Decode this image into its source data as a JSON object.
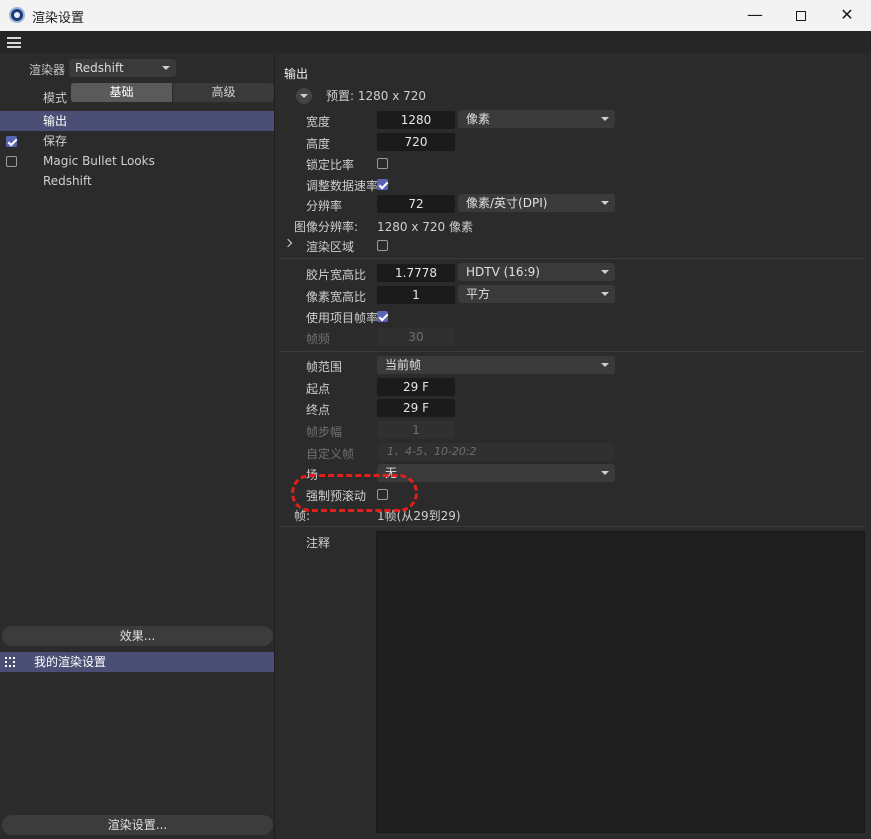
{
  "window": {
    "title": "渲染设置",
    "min_glyph": "—",
    "close_glyph": "✕"
  },
  "left": {
    "renderer_label": "渲染器",
    "renderer_value": "Redshift",
    "mode_label": "模式",
    "mode_basic": "基础",
    "mode_advanced": "高级",
    "items": [
      {
        "label": "输出",
        "checkbox": null,
        "selected": true
      },
      {
        "label": "保存",
        "checkbox": true,
        "selected": false
      },
      {
        "label": "Magic Bullet Looks",
        "checkbox": false,
        "selected": false
      },
      {
        "label": "Redshift",
        "checkbox": null,
        "selected": false
      }
    ],
    "effects_button": "效果...",
    "preset_item": "我的渲染设置",
    "render_settings_button": "渲染设置..."
  },
  "output": {
    "title": "输出",
    "preset": "预置: 1280 x 720",
    "width_label": "宽度",
    "width_value": "1280",
    "width_unit": "像素",
    "height_label": "高度",
    "height_value": "720",
    "lock_ratio_label": "锁定比率",
    "adjust_rate_label": "调整数据速率",
    "resolution_label": "分辨率",
    "resolution_value": "72",
    "resolution_unit": "像素/英寸(DPI)",
    "image_res_label": "图像分辨率:",
    "image_res_value": "1280 x 720 像素",
    "render_region_label": "渲染区域",
    "film_aspect_label": "胶片宽高比",
    "film_aspect_value": "1.7778",
    "film_aspect_preset": "HDTV (16:9)",
    "pixel_aspect_label": "像素宽高比",
    "pixel_aspect_value": "1",
    "pixel_aspect_preset": "平方",
    "use_project_fps_label": "使用项目帧率",
    "fps_label": "帧频",
    "fps_value": "30",
    "frame_range_label": "帧范围",
    "frame_range_value": "当前帧",
    "start_label": "起点",
    "start_value": "29 F",
    "end_label": "终点",
    "end_value": "29 F",
    "frame_step_label": "帧步幅",
    "frame_step_value": "1",
    "custom_frames_label": "自定义帧",
    "custom_frames_placeholder": "1、4-5、10-20:2",
    "field_label": "场",
    "field_value": "无",
    "force_preroll_label": "强制预滚动",
    "frames_label": "帧:",
    "frames_value": "1帧(从29到29)",
    "notes_label": "注释"
  }
}
